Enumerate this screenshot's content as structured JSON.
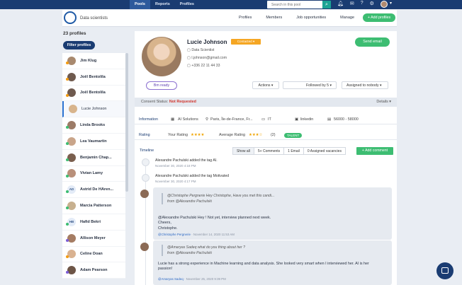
{
  "topbar": {
    "tabs": [
      "Pools",
      "Reports",
      "Profiles"
    ],
    "active_tab": "Pools",
    "search_placeholder": "Search in this pool"
  },
  "header": {
    "pool_name": "Data scientists",
    "nav": [
      "Profiles",
      "Members",
      "Job opportunities",
      "Manage"
    ],
    "add_profiles": "+ Add profiles"
  },
  "sidebar": {
    "count": "23 profiles",
    "filter": "Filter profiles",
    "profiles": [
      {
        "name": "Jim Klug",
        "dot": "#f39c12",
        "avatar": "#a8896e"
      },
      {
        "name": "Joël Bentolila",
        "dot": "#f39c12",
        "avatar": "#6f5a4e"
      },
      {
        "name": "Joël Bentolila",
        "dot": "#f39c12",
        "avatar": "#6f5a4e"
      },
      {
        "name": "Lucie Johnson",
        "dot": "",
        "avatar": "#d8b48c",
        "selected": true
      },
      {
        "name": "Linda Brooks",
        "dot": "#3dbd72",
        "avatar": "#9c7b67"
      },
      {
        "name": "Lea Vaumartin",
        "dot": "#3dbd72",
        "avatar": "#c9a58a"
      },
      {
        "name": "Benjamin Chap...",
        "dot": "#3dbd72",
        "avatar": "#7a5f4e"
      },
      {
        "name": "Vivian Lamy",
        "dot": "#3dbd72",
        "avatar": "#b9907a"
      },
      {
        "name": "Astrid De HAren...",
        "dot": "#3dbd72",
        "avatar": "",
        "initials": "AD"
      },
      {
        "name": "Marcia Patterson",
        "dot": "#3dbd72",
        "avatar": "#c7b08f"
      },
      {
        "name": "Hafid Bekri",
        "dot": "#3dbd72",
        "avatar": "",
        "initials": "HB"
      },
      {
        "name": "Allison Meyer",
        "dot": "#7b5cd6",
        "avatar": "#a57c63"
      },
      {
        "name": "Celine Doan",
        "dot": "#f39c12",
        "avatar": "#d9b290"
      },
      {
        "name": "Adam Pearson",
        "dot": "#7b5cd6",
        "avatar": "#6d5547"
      }
    ]
  },
  "profile": {
    "name": "Lucie Johnson",
    "status": "Contacted ▾",
    "title": "Data Scientist",
    "email": "l.johnson@gmail.com",
    "phone": "+336 22 11 44 33",
    "send_email": "Send email",
    "ready": "Bm ready",
    "actions": "Actions ▾",
    "followed_by": "Followed by 5 ▾",
    "assigned": "Assigned to nobody ▾"
  },
  "consent": {
    "label": "Consent Status:",
    "value": "Not Requested",
    "details": "Details ▾"
  },
  "information": {
    "label": "Information",
    "company": "AI Solutions",
    "location": "Paris, Île-de-France, Fr...",
    "sector": "IT",
    "linkedin": "linkedin",
    "salary": "56000 - 58000"
  },
  "rating": {
    "label": "Rating",
    "your_rating": "Your Rating",
    "your_stars": "★★★★",
    "avg_label": "Average Rating",
    "avg_stars": "★★★☆",
    "avg_count": "(2)",
    "talent": "TALENT"
  },
  "timeline": {
    "label": "Timeline",
    "tabs": [
      "Show all",
      "5+ Comments",
      "1 Email",
      "0 Assigned vacancies"
    ],
    "add_comment": "+ Add comment",
    "events": [
      {
        "text": "Alexandre Pachulski added the tag AI.",
        "date": "November 30, 2020 4:18 PM"
      },
      {
        "text": "Alexandre Pachulski added the tag Motivated",
        "date": "November 30, 2020 4:17 PM"
      }
    ],
    "comments": [
      {
        "quote1": "@Christophe Pergnerie Hey Christophe, Have you met this candi...",
        "quote2": "from @Alexandre Pachulski",
        "lines": [
          "@Alexandre Pachulski Hey ! Not yet, interview planned next week.",
          "Cheers,",
          "Christophe."
        ],
        "author": "@Christophe Pergnerie",
        "date": "· November 14, 2020 11:53 AM"
      },
      {
        "quote1": "@Amaryas Sadeq what do you thing about her ?",
        "quote2": "from @Alexandre Pachulski",
        "lines": [
          "Lucie has a strong experience in Machine learning and data analysis. She looked very smart when I interviewed her. AI is her",
          "passion!"
        ],
        "author": "@Amaryas Sadeq",
        "date": "· November 25, 2020 9:39 PM"
      }
    ]
  }
}
